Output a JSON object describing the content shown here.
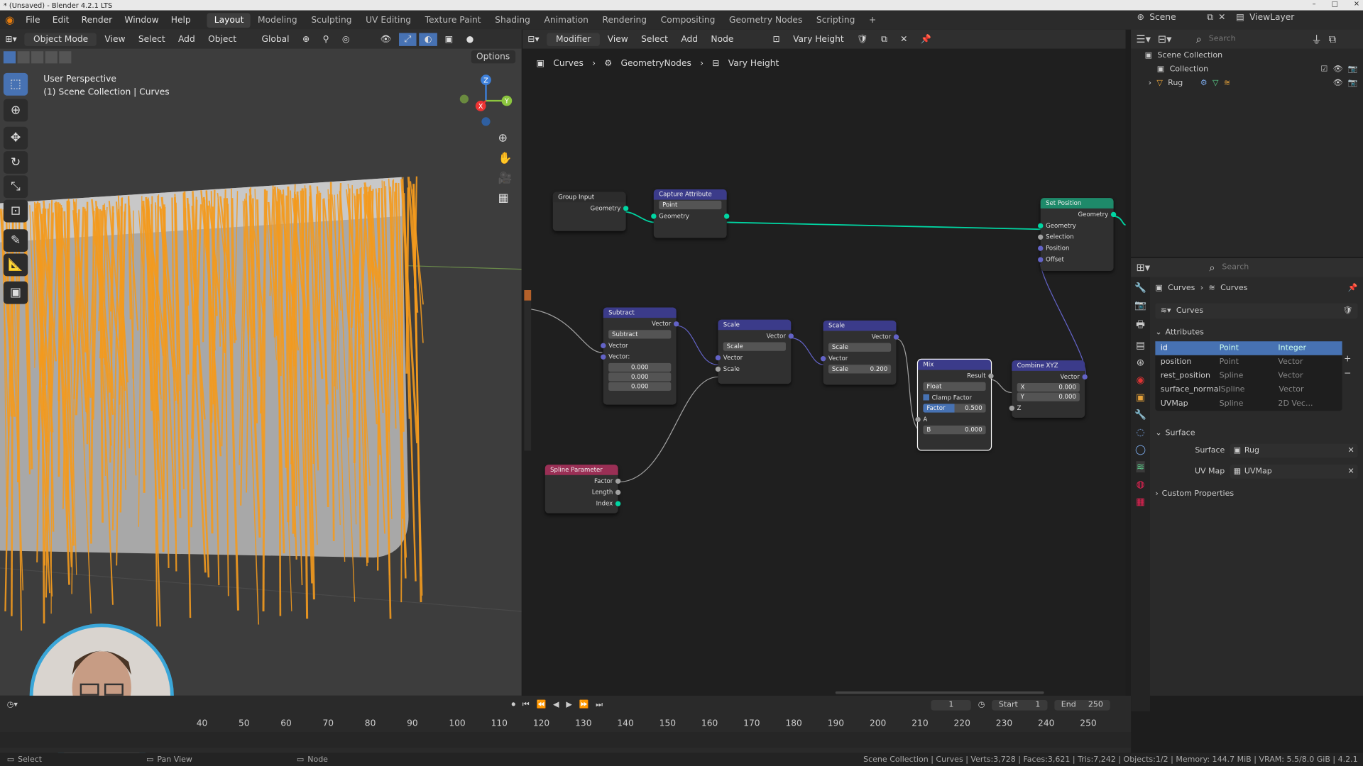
{
  "window_title": "* (Unsaved) - Blender 4.2.1 LTS",
  "menu": [
    "File",
    "Edit",
    "Render",
    "Window",
    "Help"
  ],
  "workspaces": [
    "Layout",
    "Modeling",
    "Sculpting",
    "UV Editing",
    "Texture Paint",
    "Shading",
    "Animation",
    "Rendering",
    "Compositing",
    "Geometry Nodes",
    "Scripting"
  ],
  "active_workspace": "Layout",
  "scene_label": "Scene",
  "viewlayer_label": "ViewLayer",
  "viewport": {
    "mode": "Object Mode",
    "menus": [
      "View",
      "Select",
      "Add",
      "Object"
    ],
    "orientation": "Global",
    "options_label": "Options",
    "overlay_line1": "User Perspective",
    "overlay_line2": "(1) Scene Collection | Curves",
    "gizmo": {
      "x": "X",
      "y": "Y",
      "z": "Z"
    }
  },
  "node_editor": {
    "type": "Modifier",
    "menus": [
      "View",
      "Select",
      "Add",
      "Node"
    ],
    "tree_name": "Vary Height",
    "breadcrumb": [
      "Curves",
      "GeometryNodes",
      "Vary Height"
    ],
    "nodes": {
      "group_input": {
        "title": "Group Input",
        "out": "Geometry"
      },
      "capture": {
        "title": "Capture Attribute",
        "domain": "Point",
        "geo": "Geometry"
      },
      "set_position": {
        "title": "Set Position",
        "out": "Geometry",
        "inputs": [
          "Geometry",
          "Selection",
          "Position",
          "Offset"
        ]
      },
      "subtract": {
        "title": "Subtract",
        "out": "Vector",
        "op": "Subtract",
        "in1": "Vector",
        "in2": "Vector:",
        "vals": [
          "0.000",
          "0.000",
          "0.000"
        ]
      },
      "scale1": {
        "title": "Scale",
        "out": "Vector",
        "op": "Scale",
        "in1": "Vector",
        "in2": "Scale"
      },
      "scale2": {
        "title": "Scale",
        "out": "Vector",
        "op": "Scale",
        "in1": "Vector",
        "scale_label": "Scale",
        "scale_val": "0.200"
      },
      "mix": {
        "title": "Mix",
        "out": "Result",
        "type": "Float",
        "clamp": "Clamp Factor",
        "factor_label": "Factor",
        "factor_val": "0.500",
        "a": "A",
        "b": "B",
        "b_val": "0.000"
      },
      "combine": {
        "title": "Combine XYZ",
        "out": "Vector",
        "x": "X",
        "x_val": "0.000",
        "y": "Y",
        "y_val": "0.000",
        "z": "Z"
      },
      "spline": {
        "title": "Spline Parameter",
        "outs": [
          "Factor",
          "Length",
          "Index"
        ]
      }
    }
  },
  "outliner": {
    "search_placeholder": "Search",
    "root": "Scene Collection",
    "collection": "Collection",
    "object": "Rug"
  },
  "properties": {
    "search_placeholder": "Search",
    "breadcrumb": [
      "Curves",
      "Curves"
    ],
    "data_name": "Curves",
    "attributes_label": "Attributes",
    "attributes": [
      {
        "name": "id",
        "domain": "Point",
        "type": "Integer"
      },
      {
        "name": "position",
        "domain": "Point",
        "type": "Vector"
      },
      {
        "name": "rest_position",
        "domain": "Spline",
        "type": "Vector"
      },
      {
        "name": "surface_normal",
        "domain": "Spline",
        "type": "Vector"
      },
      {
        "name": "UVMap",
        "domain": "Spline",
        "type": "2D Vec..."
      }
    ],
    "surface_label": "Surface",
    "surface_field": "Surface",
    "surface_value": "Rug",
    "uvmap_field": "UV Map",
    "uvmap_value": "UVMap",
    "custom_label": "Custom Properties"
  },
  "timeline": {
    "current_frame": "1",
    "start_label": "Start",
    "start": "1",
    "end_label": "End",
    "end": "250",
    "ticks": [
      "40",
      "50",
      "60",
      "70",
      "80",
      "90",
      "100",
      "110",
      "120",
      "130",
      "140",
      "150",
      "160",
      "170",
      "180",
      "190",
      "200",
      "210",
      "220",
      "230",
      "240",
      "250"
    ]
  },
  "status": {
    "left": [
      "Select",
      "Pan View",
      "Node"
    ],
    "right": "Scene Collection | Curves | Verts:3,728 | Faces:3,621 | Tris:7,242 | Objects:1/2 | Memory: 144.7 MiB | VRAM: 5.5/8.0 GiB | 4.2.1"
  },
  "colors": {
    "accent": "#4772b3",
    "hair": "#f39a1e",
    "geo_link": "#00d6a3",
    "vector_socket": "#6363c7"
  }
}
